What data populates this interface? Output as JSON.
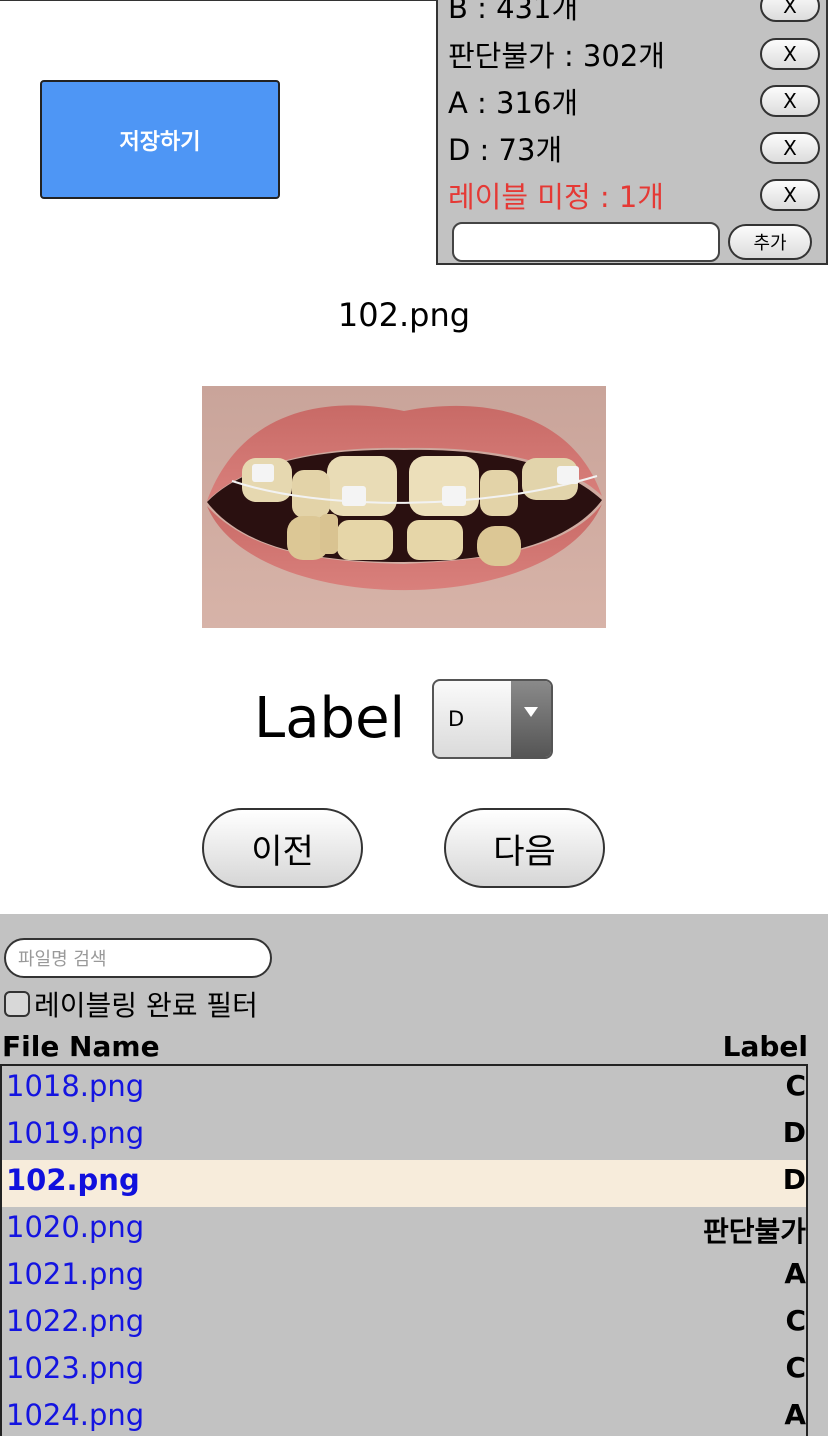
{
  "toolbar": {
    "save_label": "저장하기"
  },
  "label_panel": {
    "items": [
      {
        "text": "B : 431개",
        "highlight": false
      },
      {
        "text": "판단불가 : 302개",
        "highlight": false
      },
      {
        "text": "A : 316개",
        "highlight": false
      },
      {
        "text": "D : 73개",
        "highlight": false
      },
      {
        "text": "레이블 미정 : 1개",
        "highlight": true
      }
    ],
    "remove_label": "X",
    "add_input_value": "",
    "add_label": "추가"
  },
  "viewer": {
    "filename": "102.png",
    "label_caption": "Label",
    "selected_label": "D"
  },
  "nav": {
    "prev_label": "이전",
    "next_label": "다음"
  },
  "list": {
    "search_placeholder": "파일명 검색",
    "filter_label": "레이블링 완료 필터",
    "filter_checked": false,
    "headers": {
      "file_name": "File Name",
      "label": "Label"
    },
    "rows": [
      {
        "file": "1018.png",
        "label": "C",
        "selected": false
      },
      {
        "file": "1019.png",
        "label": "D",
        "selected": false
      },
      {
        "file": "102.png",
        "label": "D",
        "selected": true
      },
      {
        "file": "1020.png",
        "label": "판단불가",
        "selected": false
      },
      {
        "file": "1021.png",
        "label": "A",
        "selected": false
      },
      {
        "file": "1022.png",
        "label": "C",
        "selected": false
      },
      {
        "file": "1023.png",
        "label": "C",
        "selected": false
      },
      {
        "file": "1024.png",
        "label": "A",
        "selected": false
      }
    ]
  },
  "colors": {
    "accent": "#4e96f5",
    "panel_bg": "#c2c2c2",
    "warning_text": "#e53935",
    "link_text": "#1414e0",
    "selected_row_bg": "#f7ecdb"
  },
  "icons": {
    "dropdown": "triangle-down-icon",
    "close": "x-icon"
  }
}
